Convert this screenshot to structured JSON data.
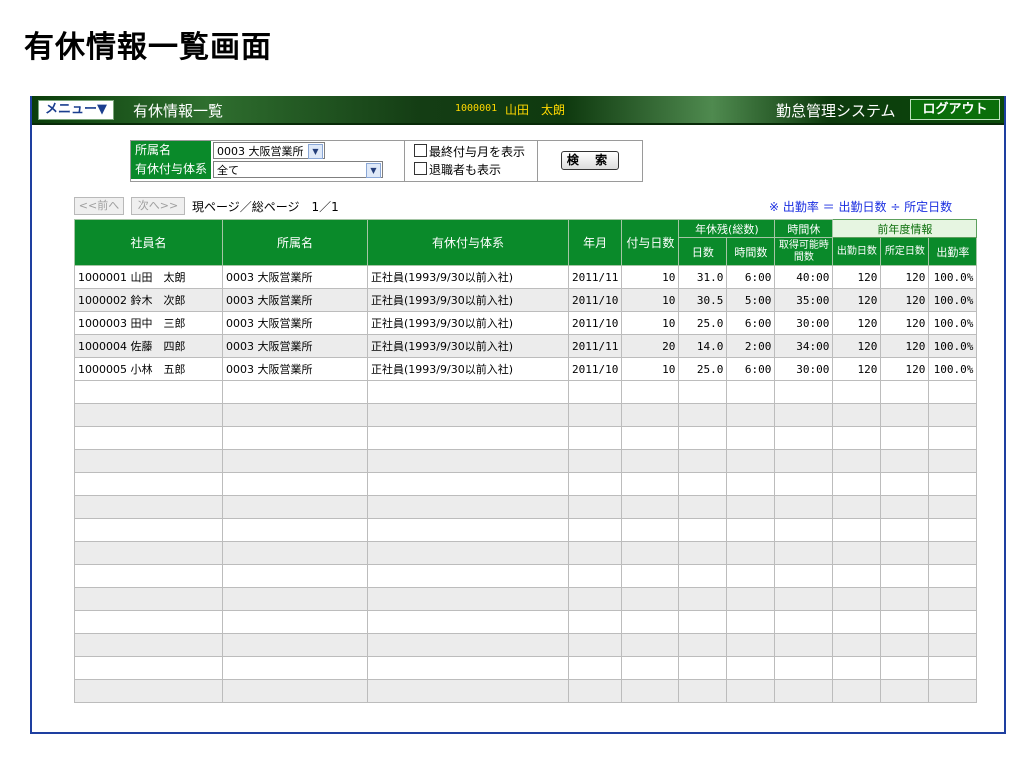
{
  "page": {
    "title": "有休情報一覧画面"
  },
  "topbar": {
    "menu_label": "メニュー▼",
    "screen_name": "有休情報一覧",
    "user_id": "1000001",
    "user_name": "山田　太朗",
    "system_name": "勤怠管理システム",
    "logout_label": "ログアウト"
  },
  "search": {
    "dept_label": "所属名",
    "dept_value": "0003 大阪営業所",
    "grant_label": "有休付与体系",
    "grant_value": "全て",
    "show_last_grant_label": "最終付与月を表示",
    "show_retired_label": "退職者も表示",
    "search_button": "検 索"
  },
  "pager": {
    "prev_label": "<<前へ",
    "next_label": "次へ>>",
    "info": "現ページ／総ページ　1／1"
  },
  "ratio_note": "※ 出勤率 ＝ 出勤日数 ÷ 所定日数",
  "table": {
    "headers": {
      "employee": "社員名",
      "dept": "所属名",
      "grant_system": "有休付与体系",
      "year_month": "年月",
      "grant_days": "付与日数",
      "remaining_group": "年休残(総数)",
      "remaining_days": "日数",
      "remaining_hours": "時間数",
      "hourly_group": "時間休",
      "hourly_available": "取得可能時間数",
      "prev_group": "前年度情報",
      "prev_work_days": "出勤日数",
      "prev_scheduled_days": "所定日数",
      "prev_rate": "出勤率"
    },
    "rows": [
      [
        "1000001 山田　太朗",
        "0003 大阪営業所",
        "正社員(1993/9/30以前入社)",
        "2011/11",
        "10",
        "31.0",
        "6:00",
        "40:00",
        "120",
        "120",
        "100.0%"
      ],
      [
        "1000002 鈴木　次郎",
        "0003 大阪営業所",
        "正社員(1993/9/30以前入社)",
        "2011/10",
        "10",
        "30.5",
        "5:00",
        "35:00",
        "120",
        "120",
        "100.0%"
      ],
      [
        "1000003 田中　三郎",
        "0003 大阪営業所",
        "正社員(1993/9/30以前入社)",
        "2011/10",
        "10",
        "25.0",
        "6:00",
        "30:00",
        "120",
        "120",
        "100.0%"
      ],
      [
        "1000004 佐藤　四郎",
        "0003 大阪営業所",
        "正社員(1993/9/30以前入社)",
        "2011/11",
        "20",
        "14.0",
        "2:00",
        "34:00",
        "120",
        "120",
        "100.0%"
      ],
      [
        "1000005 小林　五郎",
        "0003 大阪営業所",
        "正社員(1993/9/30以前入社)",
        "2011/10",
        "10",
        "25.0",
        "6:00",
        "30:00",
        "120",
        "120",
        "100.0%"
      ]
    ],
    "empty_rows": 14
  }
}
